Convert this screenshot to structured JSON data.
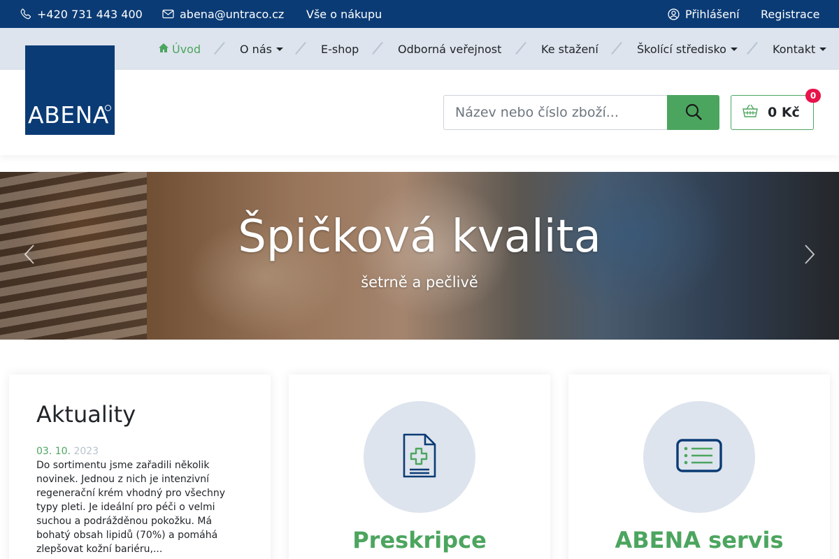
{
  "topbar": {
    "phone": "+420 731 443 400",
    "email": "abena@untraco.cz",
    "shopping_info": "Vše o nákupu",
    "login": "Přihlášení",
    "register": "Registrace"
  },
  "nav": {
    "items": [
      {
        "label": "Úvod",
        "active": true,
        "dropdown": false
      },
      {
        "label": "O nás",
        "active": false,
        "dropdown": true
      },
      {
        "label": "E-shop",
        "active": false,
        "dropdown": false
      },
      {
        "label": "Odborná veřejnost",
        "active": false,
        "dropdown": false
      },
      {
        "label": "Ke stažení",
        "active": false,
        "dropdown": false
      },
      {
        "label": "Školící středisko",
        "active": false,
        "dropdown": true
      },
      {
        "label": "Kontakt",
        "active": false,
        "dropdown": true
      }
    ]
  },
  "logo": {
    "text": "ABENA"
  },
  "search": {
    "placeholder": "Název nebo číslo zboží..."
  },
  "cart": {
    "total": "0 Kč",
    "count": "0"
  },
  "hero": {
    "title": "Špičková kvalita",
    "subtitle": "šetrně a pečlivě"
  },
  "cards": {
    "news": {
      "title": "Aktuality",
      "date_day": "03. 10.",
      "date_year": "2023",
      "text": "Do sortimentu jsme zařadili několik novinek. Jednou z nich je intenzivní regenerační krém vhodný pro všechny typy pleti. Je ideální pro péči o velmi suchou a podrážděnou pokožku. Má bohatý obsah lipidů (70%) a pomáhá zlepšovat kožní bariéru,..."
    },
    "prescription": {
      "title": "Preskripce"
    },
    "service": {
      "title": "ABENA servis"
    }
  },
  "colors": {
    "primary_blue": "#0b3b75",
    "accent_green": "#4ca55f",
    "nav_bg": "#dde4ed",
    "badge_red": "#e8134a"
  },
  "icons": [
    "phone-icon",
    "envelope-icon",
    "user-circle-icon",
    "home-icon",
    "search-icon",
    "basket-icon",
    "document-medical-icon",
    "list-icon",
    "chevron-left-icon",
    "chevron-right-icon"
  ]
}
